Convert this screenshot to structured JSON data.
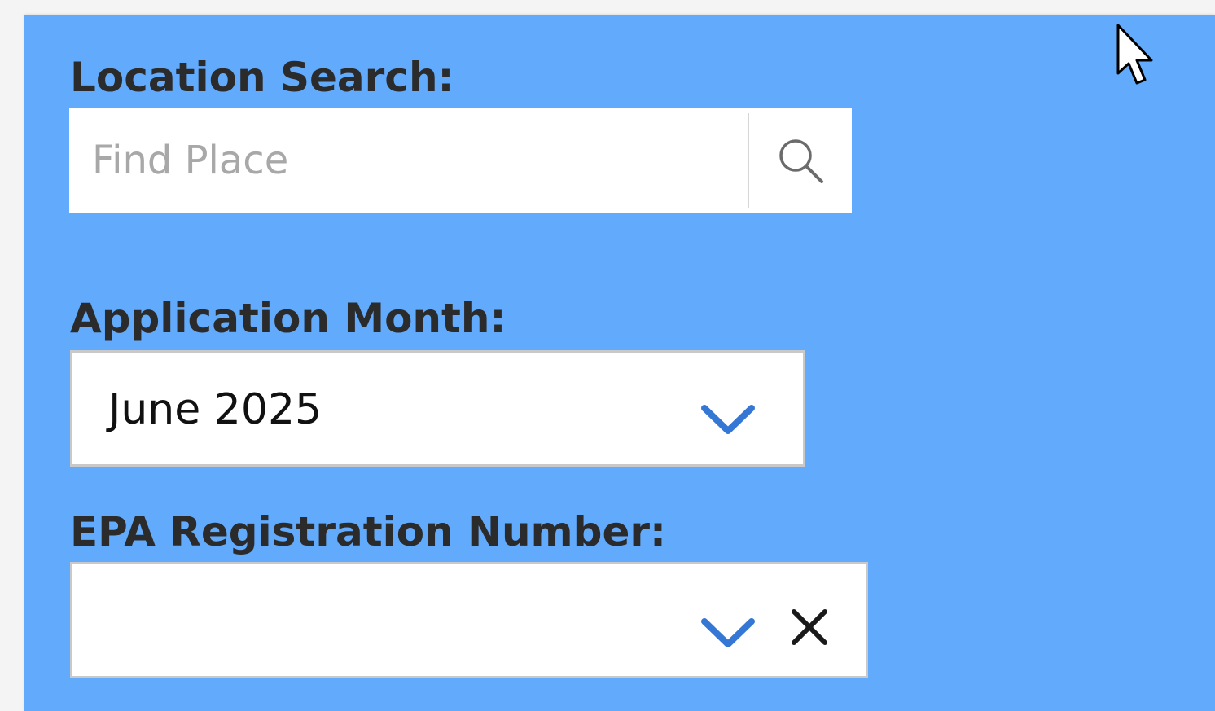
{
  "location_search": {
    "label": "Location Search:",
    "placeholder": "Find Place",
    "value": "",
    "button_icon": "search-icon"
  },
  "application_month": {
    "label": "Application Month:",
    "selected": "June 2025",
    "dropdown_icon": "chevron-down-icon"
  },
  "epa_registration": {
    "label": "EPA Registration Number:",
    "selected": "",
    "dropdown_icon": "chevron-down-icon",
    "clear_icon": "close-icon"
  },
  "colors": {
    "panel_background": "#62abfc",
    "label_text": "#2b2b2b",
    "chevron": "#3577d4",
    "field_background": "#ffffff"
  }
}
